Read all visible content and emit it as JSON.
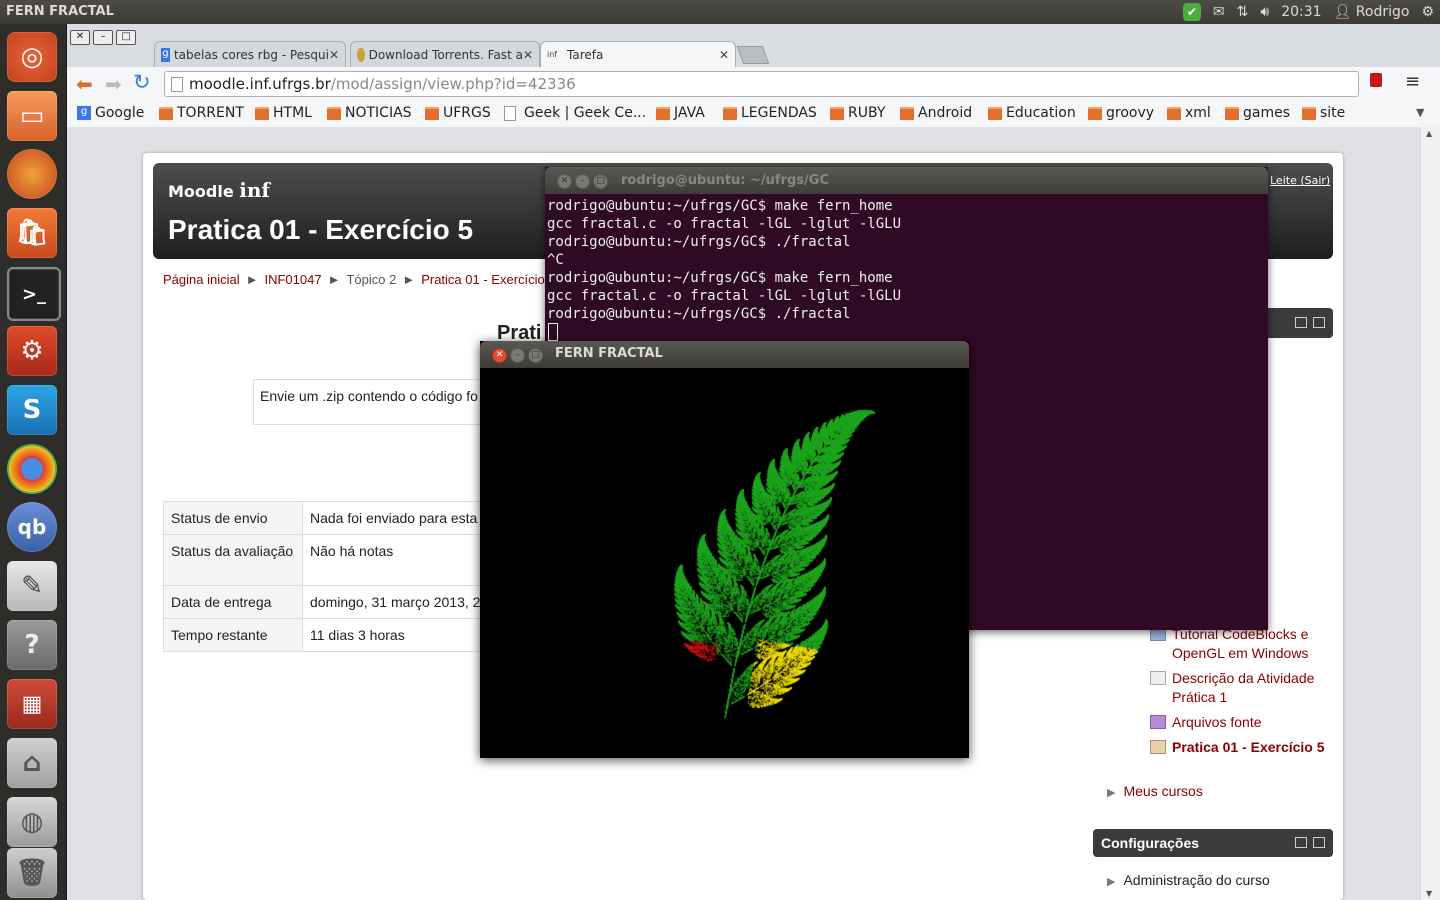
{
  "panel": {
    "title": "FERN FRACTAL",
    "clock": "20:31",
    "user": "Rodrigo"
  },
  "launcher": {
    "items": [
      "ubuntu-logo-icon",
      "files-icon",
      "firefox-icon",
      "software-center-icon",
      "terminal-icon",
      "system-settings-icon",
      "skype-icon",
      "chrome-icon",
      "qbittorrent-icon",
      "text-editor-icon",
      "help-icon",
      "workspace-switcher-icon",
      "usb-drive-icon",
      "disk-drive-icon",
      "trash-icon"
    ]
  },
  "browser": {
    "tabs": [
      {
        "label": "tabelas cores rbg - Pesqui",
        "active": false
      },
      {
        "label": "Download Torrents. Fast a",
        "active": false
      },
      {
        "label": "Tarefa",
        "active": true
      }
    ],
    "url_host": "moodle.inf.ufrgs.br",
    "url_path": "/mod/assign/view.php?id=42336",
    "bookmarks": [
      "Google",
      "TORRENT",
      "HTML",
      "NOTICIAS",
      "UFRGS",
      "Geek | Geek Ce...",
      "JAVA",
      "LEGENDAS",
      "RUBY",
      "Android",
      "Education",
      "groovy",
      "xml",
      "games",
      "site"
    ]
  },
  "moodle": {
    "logo": "Moodle",
    "logo_inf": "inf",
    "page_title": "Pratica 01 - Exercício 5",
    "login_link": "Leite",
    "logout_link": "(Sair)",
    "breadcrumb": [
      "Página inicial",
      "INF01047",
      "Tópico 2",
      "Pratica 01 - Exercício 5"
    ],
    "heading_partial": "Prati",
    "intro": "Envie um .zip contendo o código fo",
    "status_rows": [
      {
        "label": "Status de envio",
        "value": "Nada foi enviado para esta"
      },
      {
        "label": "Status da avaliação",
        "value": "Não há notas"
      },
      {
        "label": "Data de entrega",
        "value": "domingo, 31 março 2013, 2"
      },
      {
        "label": "Tempo restante",
        "value": "11 dias 3 horas"
      }
    ],
    "nav_items": [
      "Tutorial CodeBlocks e OpenGL em Windows",
      "Descrição da Atividade Prática 1",
      "Arquivos fonte",
      "Pratica 01 - Exercício 5"
    ],
    "meus_cursos": "Meus cursos",
    "config_title": "Configurações",
    "config_item": "Administração do curso"
  },
  "terminal": {
    "title": "rodrigo@ubuntu: ~/ufrgs/GC",
    "lines": [
      "rodrigo@ubuntu:~/ufrgs/GC$ make fern_home",
      "gcc fractal.c -o fractal -lGL -lglut -lGLU",
      "rodrigo@ubuntu:~/ufrgs/GC$ ./fractal",
      "^C",
      "rodrigo@ubuntu:~/ufrgs/GC$ make fern_home",
      "gcc fractal.c -o fractal -lGL -lglut -lGLU",
      "rodrigo@ubuntu:~/ufrgs/GC$ ./fractal"
    ],
    "bg_color": "#300a24"
  },
  "fern_window": {
    "title": "FERN FRACTAL",
    "colors": {
      "green": "#1fa51f",
      "red": "#d41414",
      "yellow": "#f0e000"
    }
  }
}
